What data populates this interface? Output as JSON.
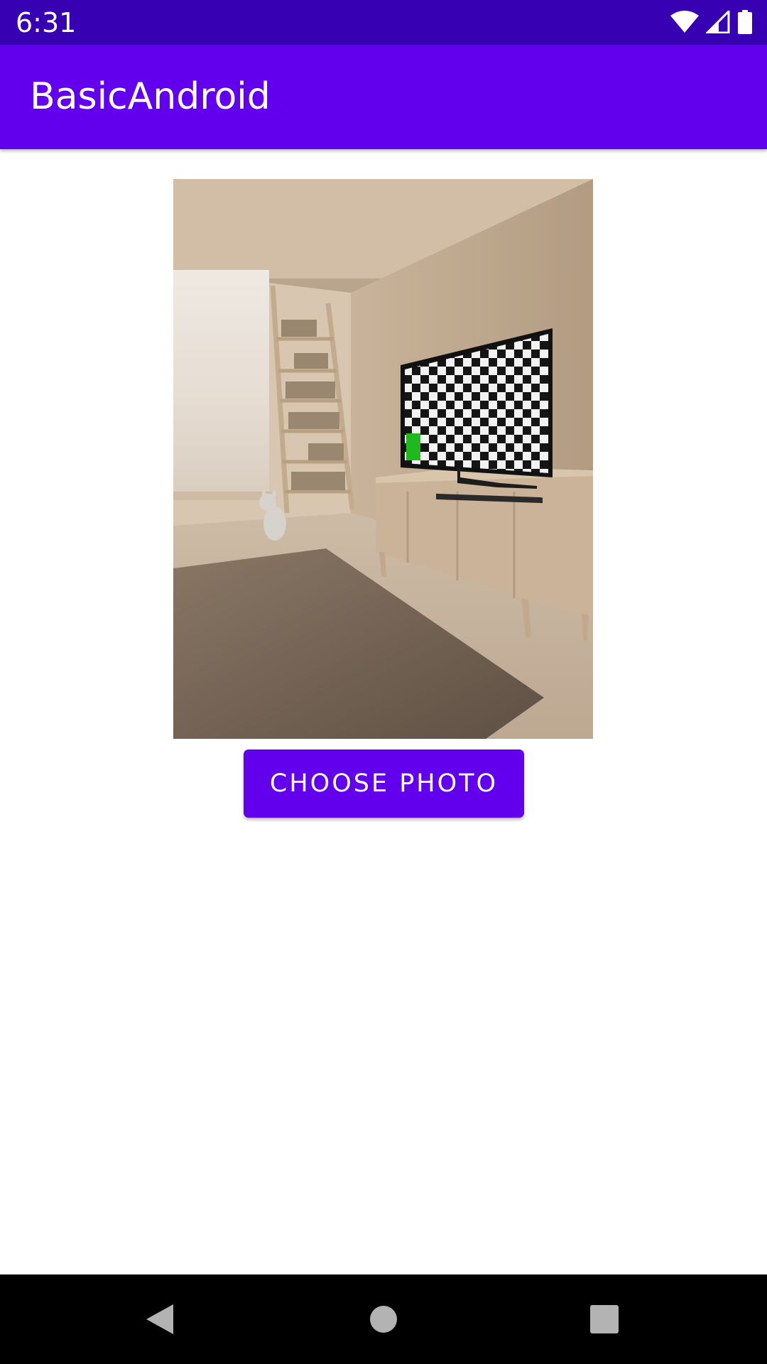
{
  "status_bar": {
    "time": "6:31",
    "icons": [
      "wifi-icon",
      "cell-signal-icon",
      "battery-icon"
    ]
  },
  "app_bar": {
    "title": "BasicAndroid"
  },
  "photo": {
    "description_icon": "room-photo"
  },
  "choose_button": {
    "label": "CHOOSE PHOTO"
  },
  "nav_bar": {
    "buttons": [
      "back-icon",
      "home-icon",
      "recents-icon"
    ]
  },
  "colors": {
    "status_bar": "#3700b3",
    "app_bar": "#6200ee",
    "button": "#6200ee",
    "nav_bar": "#000000",
    "background": "#ffffff"
  }
}
